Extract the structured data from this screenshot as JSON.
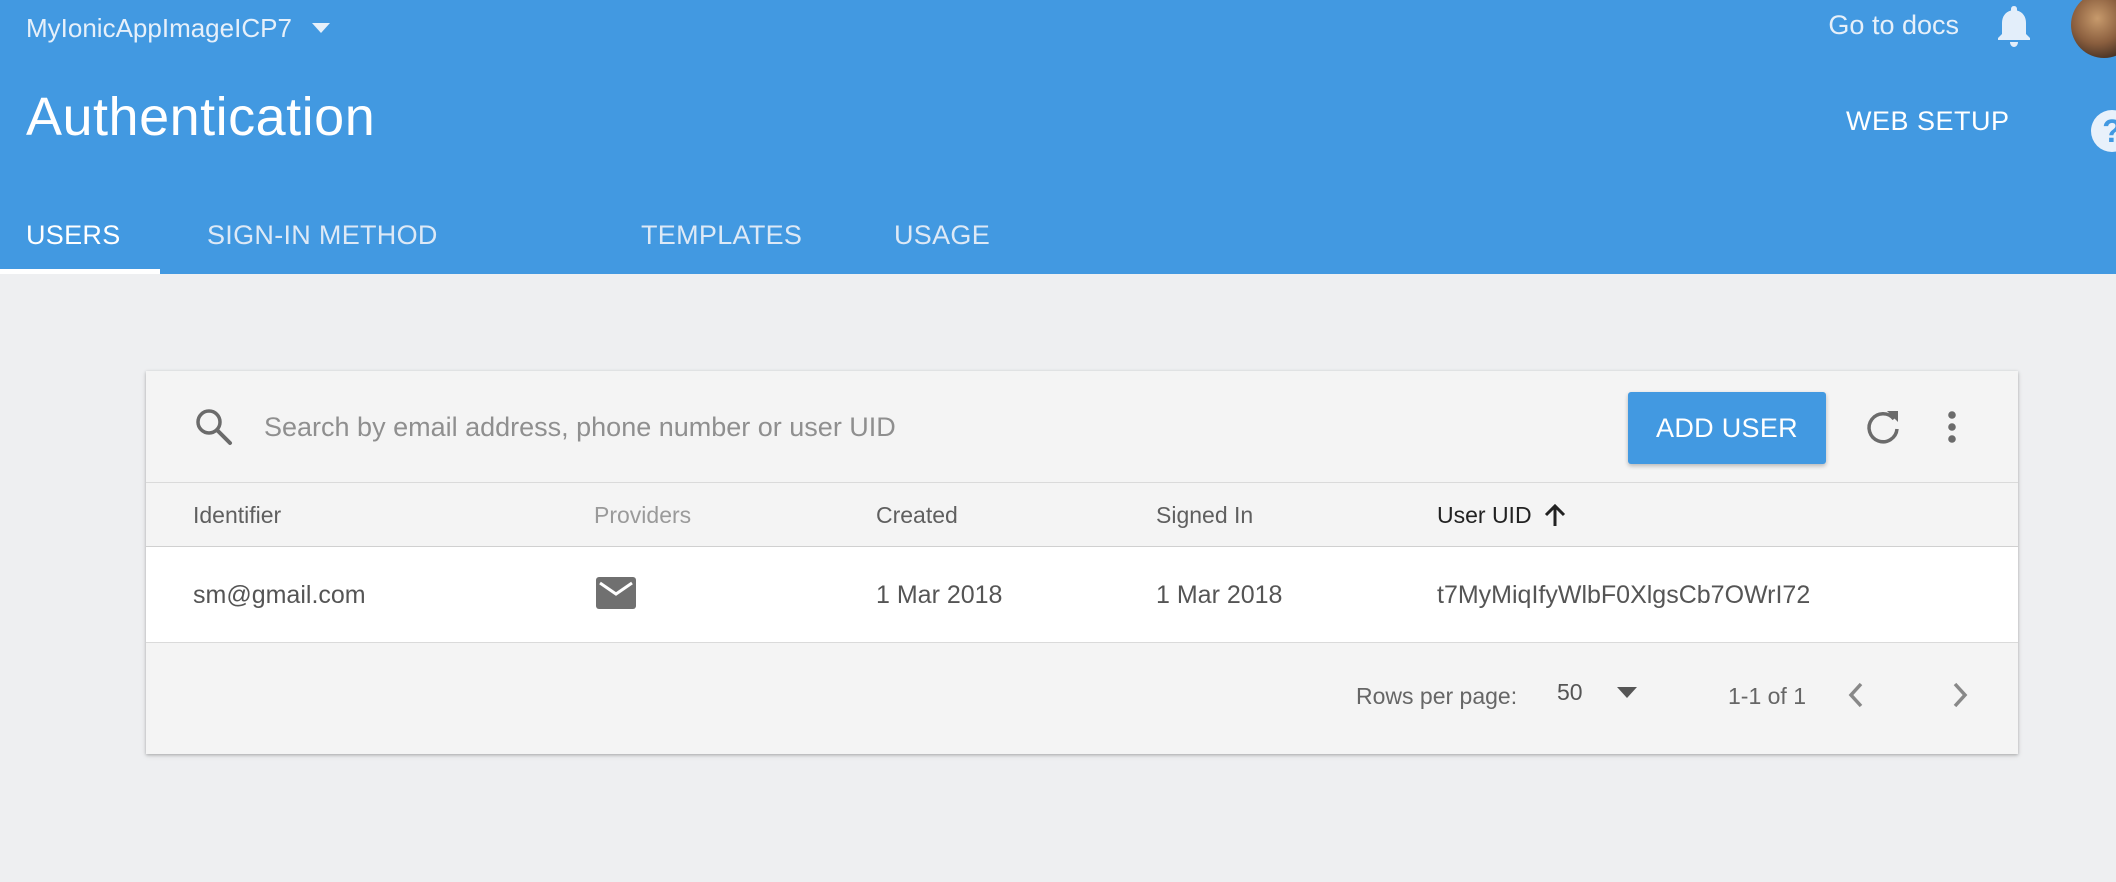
{
  "header": {
    "project_name": "MyIonicAppImageICP7",
    "docs_link": "Go to docs",
    "page_title": "Authentication",
    "web_setup": "WEB SETUP",
    "help_glyph": "?",
    "bg_color": "#4299e1"
  },
  "tabs": [
    {
      "label": "USERS",
      "active": true
    },
    {
      "label": "SIGN-IN METHOD",
      "active": false
    },
    {
      "label": "TEMPLATES",
      "active": false
    },
    {
      "label": "USAGE",
      "active": false
    }
  ],
  "toolbar": {
    "search_icon": "search-icon",
    "search_placeholder": "Search by email address, phone number or user UID",
    "add_user_label": "ADD USER",
    "refresh_icon": "refresh-icon",
    "more_icon": "more-vert-icon"
  },
  "table": {
    "columns": [
      {
        "label": "Identifier"
      },
      {
        "label": "Providers"
      },
      {
        "label": "Created"
      },
      {
        "label": "Signed In"
      },
      {
        "label": "User UID",
        "sort": "ascending"
      }
    ],
    "rows": [
      {
        "identifier": "sm@gmail.com",
        "provider_icon": "email-icon",
        "created": "1 Mar 2018",
        "signed_in": "1 Mar 2018",
        "uid": "t7MyMiqIfyWlbF0XlgsCb7OWrI72"
      }
    ]
  },
  "pagination": {
    "rows_per_page_label": "Rows per page:",
    "rows_per_page_value": "50",
    "range": "1-1 of 1"
  }
}
